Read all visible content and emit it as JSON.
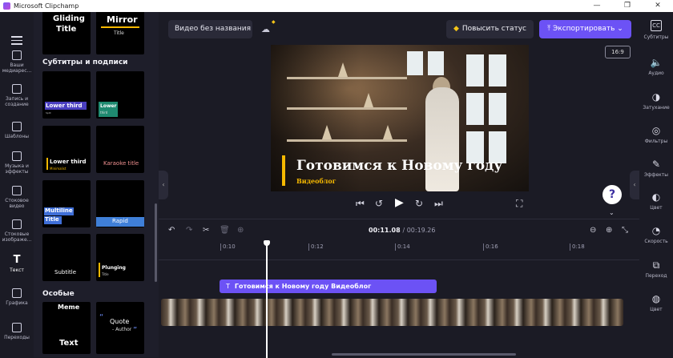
{
  "window": {
    "title": "Microsoft Clipchamp",
    "buttons": [
      "—",
      "❐",
      "✕"
    ]
  },
  "leftnav": {
    "items": [
      {
        "label": "Ваши медиарес...",
        "icon": "folder-icon"
      },
      {
        "label": "Запись и создание",
        "icon": "camera-icon"
      },
      {
        "label": "Шаблоны",
        "icon": "templates-icon"
      },
      {
        "label": "Музыка и эффекты",
        "icon": "music-icon"
      },
      {
        "label": "Стоковое видео",
        "icon": "film-icon"
      },
      {
        "label": "Стоковые изображе...",
        "icon": "image-icon"
      },
      {
        "label": "Текст",
        "icon": "text-icon",
        "glyph": "T"
      },
      {
        "label": "Графика",
        "icon": "shapes-icon"
      },
      {
        "label": "Переходы",
        "icon": "transitions-icon"
      }
    ]
  },
  "library": {
    "top_tiles": [
      {
        "line1": "Gliding",
        "line2": "Title"
      },
      {
        "line1": "Mirror",
        "line2": "Title"
      }
    ],
    "section_subtitles": "Субтитры и подписи",
    "tiles": [
      {
        "label": "Lower third",
        "sub": "Split"
      },
      {
        "label": "Lower",
        "label2": "third"
      },
      {
        "label": "Lower third",
        "sub": "Minimalist"
      },
      {
        "label": "Karaoke title"
      },
      {
        "label": "Multiline",
        "label2": "Title"
      },
      {
        "label": "Rapid"
      },
      {
        "label": "Subtitle"
      },
      {
        "label": "Plunging",
        "sub": "Title"
      }
    ],
    "section_special": "Особые",
    "special_tiles": [
      {
        "line1": "Meme",
        "line2": "Text"
      },
      {
        "line1": "Quote",
        "line2": "- Author"
      }
    ]
  },
  "toolbar": {
    "project_name": "Видео без названия",
    "upgrade_label": "Повысить статус",
    "export_label": "Экспортировать",
    "aspect_ratio": "16:9"
  },
  "preview": {
    "title": "Готовимся к Новому году",
    "subtitle": "Видеоблог",
    "accent": "#f5b800"
  },
  "help_label": "?",
  "rightnav": {
    "items": [
      {
        "label": "Субтитры",
        "icon": "captions-icon",
        "glyph": "CC"
      },
      {
        "label": "Аудио",
        "icon": "audio-icon",
        "glyph": "🔈"
      },
      {
        "label": "Затухание",
        "icon": "fade-icon",
        "glyph": "◑"
      },
      {
        "label": "Фильтры",
        "icon": "filters-icon",
        "glyph": "◎"
      },
      {
        "label": "Эффекты",
        "icon": "effects-icon",
        "glyph": "✎"
      },
      {
        "label": "Цвет",
        "icon": "color-icon",
        "glyph": "◐"
      },
      {
        "label": "Скорость",
        "icon": "speed-icon",
        "glyph": "◔"
      },
      {
        "label": "Переход",
        "icon": "transition-icon",
        "glyph": "⧉"
      },
      {
        "label": "Цвет",
        "icon": "color2-icon",
        "glyph": "◍"
      }
    ]
  },
  "timeline": {
    "current_time": "00:11.08",
    "total_time": "00:19.26",
    "ticks": [
      "0:10",
      "0:12",
      "0:14",
      "0:16",
      "0:18"
    ],
    "text_clip_label": "Готовимся к Новому году Видеоблог"
  },
  "colors": {
    "accent": "#6c52f5",
    "background": "#1b1b25"
  }
}
